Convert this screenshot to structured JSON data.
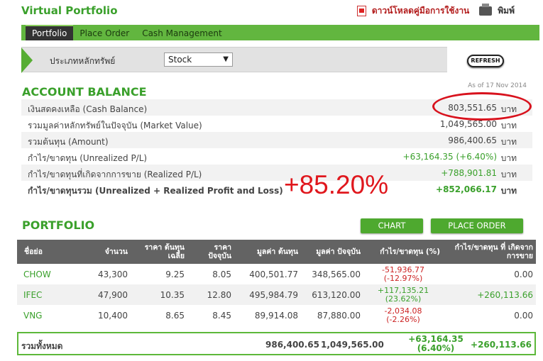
{
  "header": {
    "title": "Virtual Portfolio",
    "manual_link": "ดาวน์โหลดคู่มือการใช้งาน",
    "print_link": "พิมพ์"
  },
  "nav": {
    "tabs": [
      "Portfolio",
      "Place Order",
      "Cash Management"
    ]
  },
  "filter": {
    "label": "ประเภทหลักทรัพย์",
    "selected": "Stock",
    "refresh_label": "REFRESH"
  },
  "balance": {
    "title": "ACCOUNT BALANCE",
    "as_of": "As of 17 Nov 2014",
    "unit": "บาท",
    "rows": [
      {
        "label": "เงินสดคงเหลือ (Cash Balance)",
        "value": "803,551.65"
      },
      {
        "label": "รวมมูลค่าหลักทรัพย์ในปัจจุบัน (Market Value)",
        "value": "1,049,565.00"
      },
      {
        "label": "รวมต้นทุน (Amount)",
        "value": "986,400.65"
      },
      {
        "label": "กำไร/ขาดทุน (Unrealized P/L)",
        "value": "+63,164.35 (+6.40%)"
      },
      {
        "label": "กำไร/ขาดทุนที่เกิดจากการขาย (Realized P/L)",
        "value": "+788,901.81"
      },
      {
        "label": "กำไร/ขาดทุนรวม (Unrealized + Realized Profit and Loss)",
        "value": "+852,066.17"
      }
    ],
    "annotation": "+85.20%"
  },
  "portfolio": {
    "title": "PORTFOLIO",
    "chart_button": "CHART",
    "order_button": "PLACE ORDER",
    "columns": [
      "ชื่อย่อ",
      "จำนวน",
      "ราคา ต้นทุนเฉลี่ย",
      "ราคา ปัจจุบัน",
      "มูลค่า ต้นทุน",
      "มูลค่า ปัจจุบัน",
      "กำไร/ขาดทุน (%)",
      "กำไร/ขาดทุน ที่ เกิดจากการขาย"
    ],
    "rows": [
      {
        "symbol": "CHOW",
        "qty": "43,300",
        "avg": "9.25",
        "price": "8.05",
        "cost": "400,501.77",
        "mv": "348,565.00",
        "pl": "-51,936.77",
        "plpct": "(-12.97%)",
        "realized": "0.00"
      },
      {
        "symbol": "IFEC",
        "qty": "47,900",
        "avg": "10.35",
        "price": "12.80",
        "cost": "495,984.79",
        "mv": "613,120.00",
        "pl": "+117,135.21",
        "plpct": "(23.62%)",
        "realized": "+260,113.66"
      },
      {
        "symbol": "VNG",
        "qty": "10,400",
        "avg": "8.65",
        "price": "8.45",
        "cost": "89,914.08",
        "mv": "87,880.00",
        "pl": "-2,034.08",
        "plpct": "(-2.26%)",
        "realized": "0.00"
      }
    ],
    "total": {
      "label": "รวมทั้งหมด",
      "cost": "986,400.65",
      "mv": "1,049,565.00",
      "pl": "+63,164.35",
      "plpct": "(6.40%)",
      "realized": "+260,113.66"
    }
  }
}
